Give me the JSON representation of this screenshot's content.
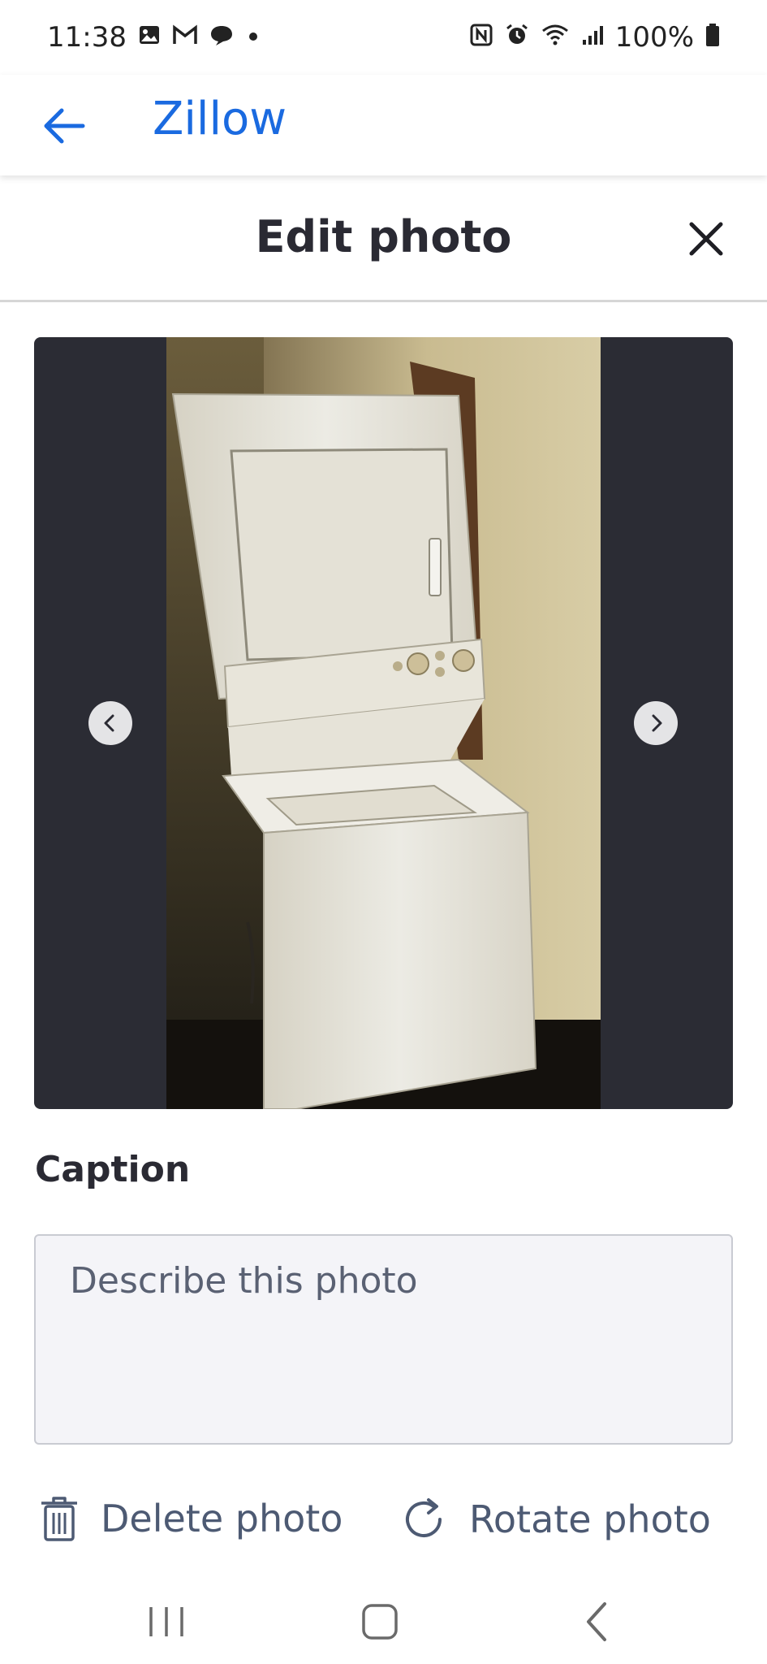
{
  "status_bar": {
    "time": "11:38",
    "battery": "100%",
    "left_icons": [
      "gallery-icon",
      "gmail-icon",
      "chat-icon",
      "dot-icon"
    ],
    "right_icons": [
      "nfc-icon",
      "alarm-icon",
      "wifi-icon",
      "signal-icon",
      "battery-icon"
    ]
  },
  "app_bar": {
    "title": "Zillow"
  },
  "dialog": {
    "title": "Edit photo"
  },
  "caption": {
    "label": "Caption",
    "placeholder": "Describe this photo",
    "value": ""
  },
  "actions": {
    "delete_label": "Delete photo",
    "rotate_label": "Rotate photo"
  },
  "colors": {
    "brand": "#1a6ae0",
    "photo_background": "#2b2c34",
    "action_text": "#4d5a73"
  }
}
